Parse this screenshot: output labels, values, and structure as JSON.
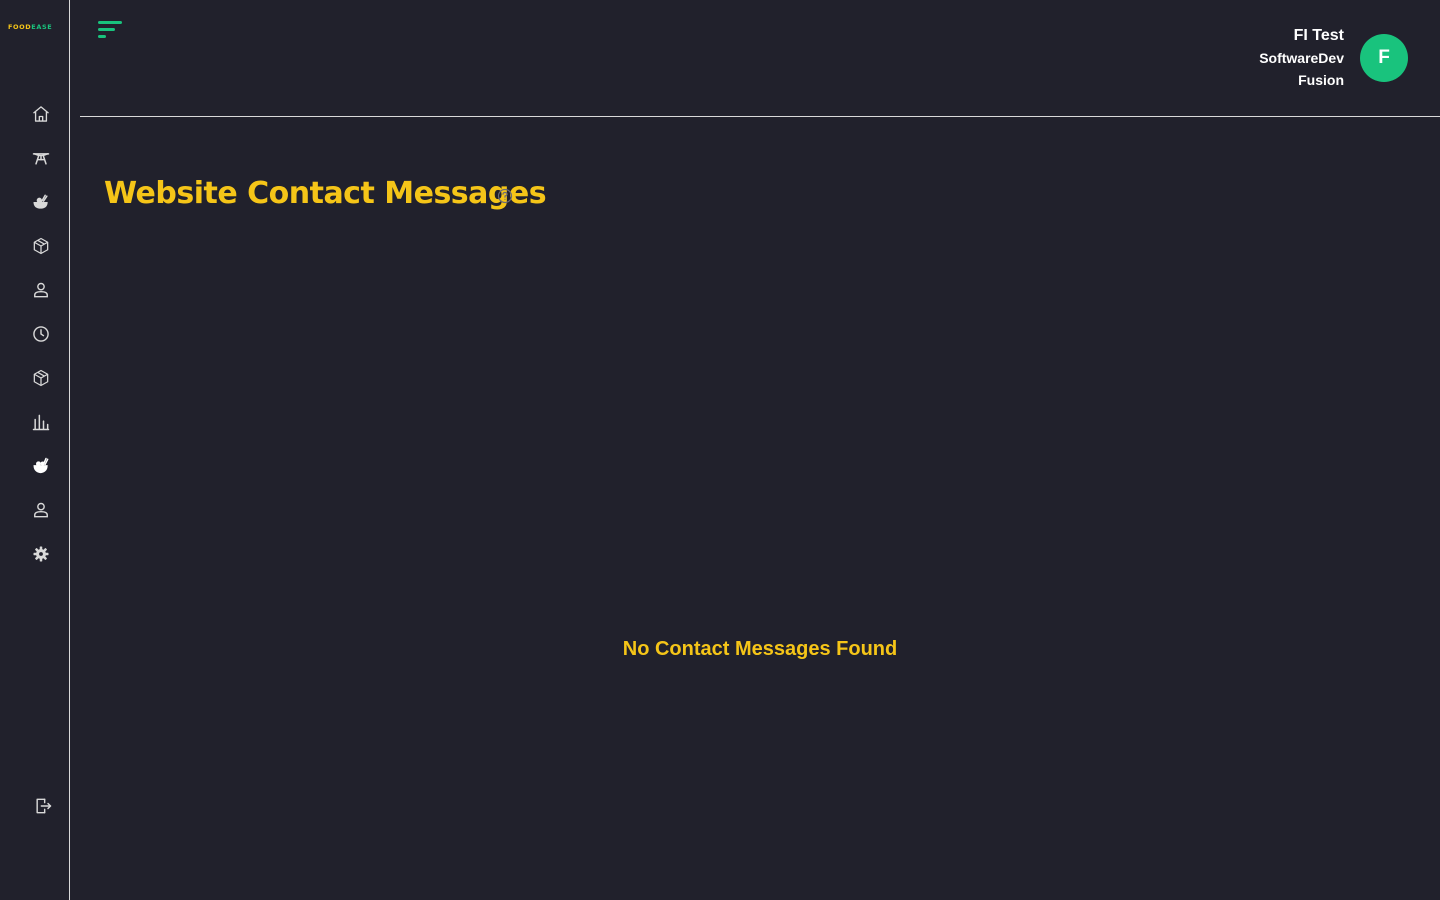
{
  "sidebar": {
    "logo": {
      "part1": "FOOD",
      "part2": "EASE"
    },
    "items": [
      {
        "icon": "home-icon"
      },
      {
        "icon": "table-icon"
      },
      {
        "icon": "food-icon"
      },
      {
        "icon": "box-icon"
      },
      {
        "icon": "user-icon"
      },
      {
        "icon": "clock-icon"
      },
      {
        "icon": "package-icon"
      },
      {
        "icon": "bar-chart-icon"
      },
      {
        "icon": "food-filled-icon"
      },
      {
        "icon": "person-icon"
      },
      {
        "icon": "gear-icon"
      }
    ],
    "logout_icon": "logout-icon"
  },
  "header": {
    "user": {
      "name": "FI Test",
      "role": "SoftwareDev",
      "org": "Fusion",
      "avatar_initial": "F"
    }
  },
  "main": {
    "title": "Website Contact Messages",
    "empty_message": "No Contact Messages Found"
  },
  "colors": {
    "background": "#21212c",
    "accent_yellow": "#f5c518",
    "accent_green": "#19c37d",
    "icon_color": "#d9d9d9"
  }
}
